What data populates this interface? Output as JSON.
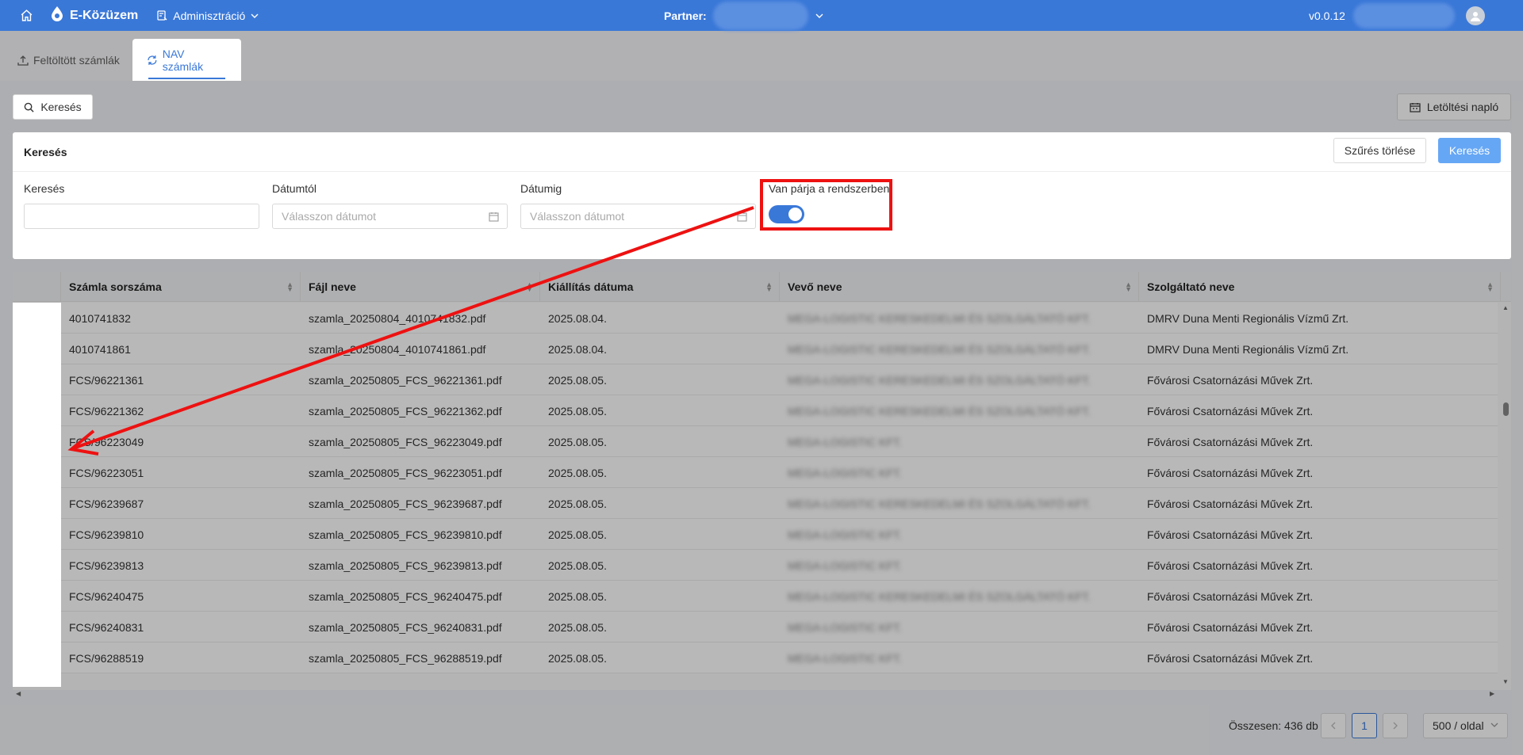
{
  "topbar": {
    "app_name": "E-Közüzem",
    "admin_menu": "Adminisztráció",
    "partner_label": "Partner:",
    "version": "v0.0.12"
  },
  "tabs": [
    {
      "label": "Feltöltött számlák"
    },
    {
      "label": "NAV számlák"
    }
  ],
  "toolbar": {
    "search_toggle": "Keresés",
    "download_log": "Letöltési napló"
  },
  "search_panel": {
    "title": "Keresés",
    "clear_button": "Szűrés törlése",
    "search_button": "Keresés",
    "fields": {
      "search_label": "Keresés",
      "search_value": "",
      "date_from_label": "Dátumtól",
      "date_from_placeholder": "Válasszon dátumot",
      "date_to_label": "Dátumig",
      "date_to_placeholder": "Válasszon dátumot",
      "has_pair_label": "Van párja a rendszerben",
      "has_pair_on": true
    }
  },
  "table": {
    "columns": [
      "Számla sorszáma",
      "Fájl neve",
      "Kiállítás dátuma",
      "Vevő neve",
      "Szolgáltató neve"
    ],
    "rows": [
      {
        "number": "4010741832",
        "file": "szamla_20250804_4010741832.pdf",
        "date": "2025.08.04.",
        "buyer": "MEGA-LOGISTIC KERESKEDELMI ÉS SZOLGÁLTATÓ KFT.",
        "provider": "DMRV Duna Menti Regionális Vízmű Zrt."
      },
      {
        "number": "4010741861",
        "file": "szamla_20250804_4010741861.pdf",
        "date": "2025.08.04.",
        "buyer": "MEGA-LOGISTIC KERESKEDELMI ÉS SZOLGÁLTATÓ KFT.",
        "provider": "DMRV Duna Menti Regionális Vízmű Zrt."
      },
      {
        "number": "FCS/96221361",
        "file": "szamla_20250805_FCS_96221361.pdf",
        "date": "2025.08.05.",
        "buyer": "MEGA-LOGISTIC KERESKEDELMI ÉS SZOLGÁLTATÓ KFT.",
        "provider": "Fővárosi Csatornázási Művek Zrt."
      },
      {
        "number": "FCS/96221362",
        "file": "szamla_20250805_FCS_96221362.pdf",
        "date": "2025.08.05.",
        "buyer": "MEGA-LOGISTIC KERESKEDELMI ÉS SZOLGÁLTATÓ KFT.",
        "provider": "Fővárosi Csatornázási Művek Zrt."
      },
      {
        "number": "FCS/96223049",
        "file": "szamla_20250805_FCS_96223049.pdf",
        "date": "2025.08.05.",
        "buyer": "MEGA-LOGISTIC KFT.",
        "provider": "Fővárosi Csatornázási Művek Zrt."
      },
      {
        "number": "FCS/96223051",
        "file": "szamla_20250805_FCS_96223051.pdf",
        "date": "2025.08.05.",
        "buyer": "MEGA-LOGISTIC KFT.",
        "provider": "Fővárosi Csatornázási Művek Zrt."
      },
      {
        "number": "FCS/96239687",
        "file": "szamla_20250805_FCS_96239687.pdf",
        "date": "2025.08.05.",
        "buyer": "MEGA-LOGISTIC KERESKEDELMI ÉS SZOLGÁLTATÓ KFT.",
        "provider": "Fővárosi Csatornázási Művek Zrt."
      },
      {
        "number": "FCS/96239810",
        "file": "szamla_20250805_FCS_96239810.pdf",
        "date": "2025.08.05.",
        "buyer": "MEGA-LOGISTIC KFT.",
        "provider": "Fővárosi Csatornázási Művek Zrt."
      },
      {
        "number": "FCS/96239813",
        "file": "szamla_20250805_FCS_96239813.pdf",
        "date": "2025.08.05.",
        "buyer": "MEGA-LOGISTIC KFT.",
        "provider": "Fővárosi Csatornázási Művek Zrt."
      },
      {
        "number": "FCS/96240475",
        "file": "szamla_20250805_FCS_96240475.pdf",
        "date": "2025.08.05.",
        "buyer": "MEGA-LOGISTIC KERESKEDELMI ÉS SZOLGÁLTATÓ KFT.",
        "provider": "Fővárosi Csatornázási Művek Zrt."
      },
      {
        "number": "FCS/96240831",
        "file": "szamla_20250805_FCS_96240831.pdf",
        "date": "2025.08.05.",
        "buyer": "MEGA-LOGISTIC KFT.",
        "provider": "Fővárosi Csatornázási Művek Zrt."
      },
      {
        "number": "FCS/96288519",
        "file": "szamla_20250805_FCS_96288519.pdf",
        "date": "2025.08.05.",
        "buyer": "MEGA-LOGISTIC KFT.",
        "provider": "Fővárosi Csatornázási Művek Zrt."
      }
    ]
  },
  "pagination": {
    "total": "Összesen: 436 db",
    "current_page": "1",
    "page_size": "500 / oldal"
  },
  "colors": {
    "primary": "#3a78d8",
    "annotation_red": "#ee1111"
  }
}
